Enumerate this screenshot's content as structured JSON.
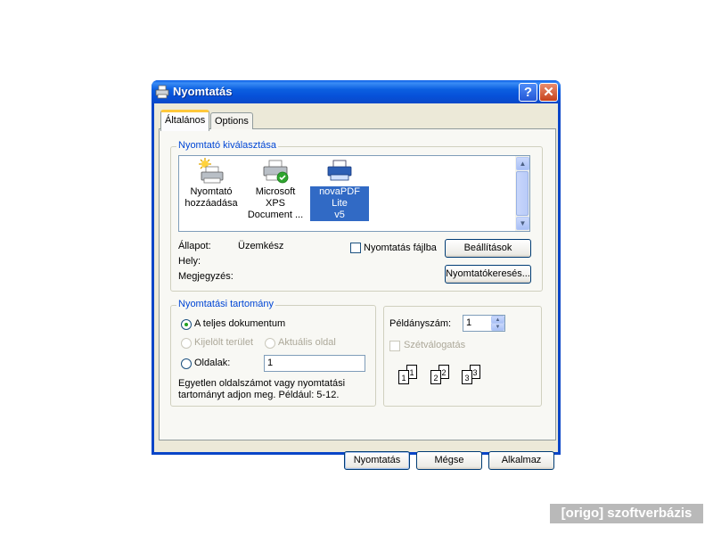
{
  "window": {
    "title": "Nyomtatás",
    "help_glyph": "?",
    "close_glyph": "✕"
  },
  "tabs": [
    {
      "label": "Általános"
    },
    {
      "label": "Options"
    }
  ],
  "printer_select": {
    "legend": "Nyomtató kiválasztása",
    "printers": [
      {
        "line1": "Nyomtató",
        "line2": "hozzáadása",
        "icon": "add-printer-icon",
        "selected": false
      },
      {
        "line1": "Microsoft XPS",
        "line2": "Document ...",
        "icon": "printer-default-check-icon",
        "selected": false
      },
      {
        "line1": "novaPDF Lite",
        "line2": "v5",
        "icon": "printer-icon",
        "selected": true
      }
    ],
    "status_label": "Állapot:",
    "status_value": "Üzemkész",
    "location_label": "Hely:",
    "comment_label": "Megjegyzés:",
    "print_to_file_label": "Nyomtatás fájlba",
    "print_to_file_checked": false,
    "settings_button": "Beállítások",
    "find_printer_button": "Nyomtatókeresés..."
  },
  "page_range": {
    "legend": "Nyomtatási tartomány",
    "all_label": "A teljes dokumentum",
    "selection_label": "Kijelölt terület",
    "current_page_label": "Aktuális oldal",
    "pages_label": "Oldalak:",
    "pages_value": "1",
    "hint_line1": "Egyetlen oldalszámot vagy nyomtatási",
    "hint_line2": "tartományt adjon meg. Például: 5-12."
  },
  "copies": {
    "label": "Példányszám:",
    "value": "1",
    "collate_label": "Szétválogatás",
    "collate_checked": false,
    "collate_pages": [
      "1",
      "1",
      "2",
      "2",
      "3",
      "3"
    ]
  },
  "buttons": {
    "print": "Nyomtatás",
    "cancel": "Mégse",
    "apply": "Alkalmaz"
  },
  "watermark": "[origo] szoftverbázis",
  "colors": {
    "title_bar": "#0a5ee6",
    "selection": "#316ac5",
    "group_legend": "#0046d5",
    "dialog_bg": "#ece9d8"
  }
}
